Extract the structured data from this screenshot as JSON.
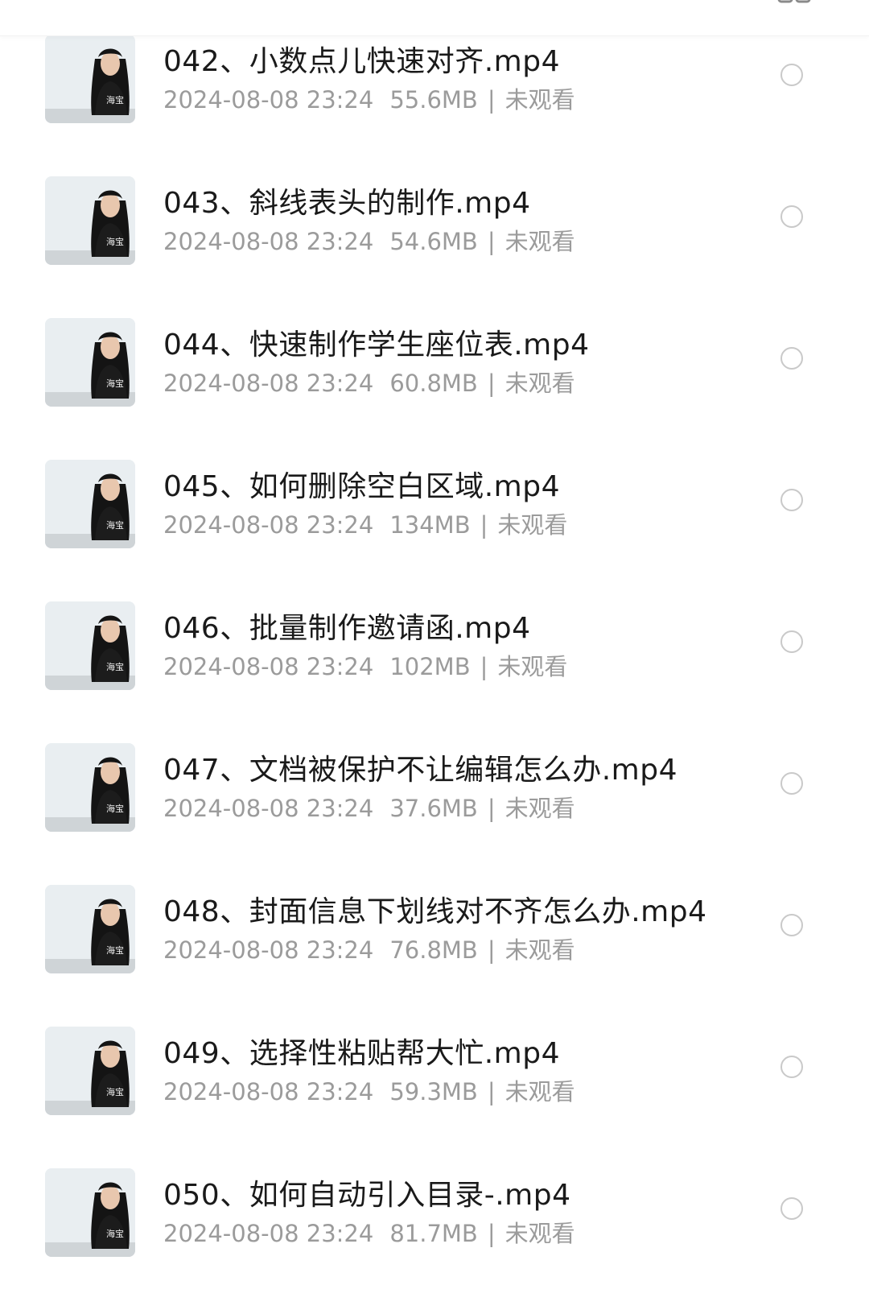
{
  "items": [
    {
      "title": "042、小数点儿快速对齐.mp4",
      "date": "2024-08-08 23:24",
      "size": "55.6MB",
      "sep": "|",
      "status": "未观看"
    },
    {
      "title": "043、斜线表头的制作.mp4",
      "date": "2024-08-08 23:24",
      "size": "54.6MB",
      "sep": "|",
      "status": "未观看"
    },
    {
      "title": "044、快速制作学生座位表.mp4",
      "date": "2024-08-08 23:24",
      "size": "60.8MB",
      "sep": "|",
      "status": "未观看"
    },
    {
      "title": "045、如何删除空白区域.mp4",
      "date": "2024-08-08 23:24",
      "size": "134MB",
      "sep": "|",
      "status": "未观看"
    },
    {
      "title": "046、批量制作邀请函.mp4",
      "date": "2024-08-08 23:24",
      "size": "102MB",
      "sep": "|",
      "status": "未观看"
    },
    {
      "title": "047、文档被保护不让编辑怎么办.mp4",
      "date": "2024-08-08 23:24",
      "size": "37.6MB",
      "sep": "|",
      "status": "未观看"
    },
    {
      "title": "048、封面信息下划线对不齐怎么办.mp4",
      "date": "2024-08-08 23:24",
      "size": "76.8MB",
      "sep": "|",
      "status": "未观看"
    },
    {
      "title": "049、选择性粘贴帮大忙.mp4",
      "date": "2024-08-08 23:24",
      "size": "59.3MB",
      "sep": "|",
      "status": "未观看"
    },
    {
      "title": "050、如何自动引入目录-.mp4",
      "date": "2024-08-08 23:24",
      "size": "81.7MB",
      "sep": "|",
      "status": "未观看"
    }
  ],
  "thumb_colors": {
    "background": "#e9eef1",
    "hoodie": "#1c1c1c",
    "hair": "#141414",
    "skin": "#e8c7ae",
    "table": "#cfd4d7"
  }
}
